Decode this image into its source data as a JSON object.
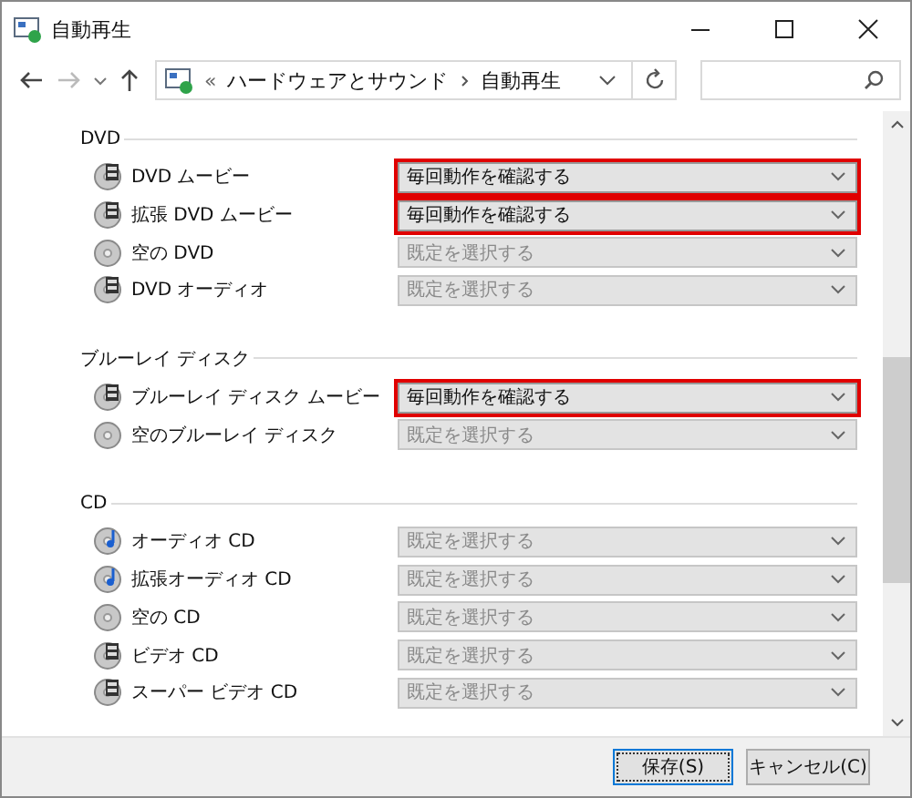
{
  "window": {
    "title": "自動再生"
  },
  "address_bar": {
    "overflow": "«",
    "path": [
      "ハードウェアとサウンド",
      "自動再生"
    ]
  },
  "sections": [
    {
      "heading": "DVD",
      "items": [
        {
          "label": "DVD ムービー",
          "kind": "video",
          "combo": {
            "value": "毎回動作を確認する",
            "highlighted": true
          }
        },
        {
          "label": "拡張 DVD ムービー",
          "kind": "video",
          "combo": {
            "value": "毎回動作を確認する",
            "highlighted": true
          }
        },
        {
          "label": "空の DVD",
          "kind": "blank",
          "combo": {
            "placeholder": "既定を選択する",
            "highlighted": false
          }
        },
        {
          "label": "DVD オーディオ",
          "kind": "video",
          "combo": {
            "placeholder": "既定を選択する",
            "highlighted": false
          }
        }
      ]
    },
    {
      "heading": "ブルーレイ ディスク",
      "items": [
        {
          "label": "ブルーレイ ディスク ムービー",
          "kind": "video",
          "combo": {
            "value": "毎回動作を確認する",
            "highlighted": true
          }
        },
        {
          "label": "空のブルーレイ ディスク",
          "kind": "blank",
          "combo": {
            "placeholder": "既定を選択する",
            "highlighted": false
          }
        }
      ]
    },
    {
      "heading": "CD",
      "items": [
        {
          "label": "オーディオ CD",
          "kind": "audio",
          "combo": {
            "placeholder": "既定を選択する",
            "highlighted": false
          }
        },
        {
          "label": "拡張オーディオ CD",
          "kind": "audio",
          "combo": {
            "placeholder": "既定を選択する",
            "highlighted": false
          }
        },
        {
          "label": "空の CD",
          "kind": "blank",
          "combo": {
            "placeholder": "既定を選択する",
            "highlighted": false
          }
        },
        {
          "label": "ビデオ CD",
          "kind": "video",
          "combo": {
            "placeholder": "既定を選択する",
            "highlighted": false
          }
        },
        {
          "label": "スーパー ビデオ CD",
          "kind": "video",
          "combo": {
            "placeholder": "既定を選択する",
            "highlighted": false
          }
        }
      ]
    }
  ],
  "buttons": [
    {
      "label": "保存(S)",
      "selected": true
    },
    {
      "label": "キャンセル(C)",
      "selected": false
    }
  ]
}
